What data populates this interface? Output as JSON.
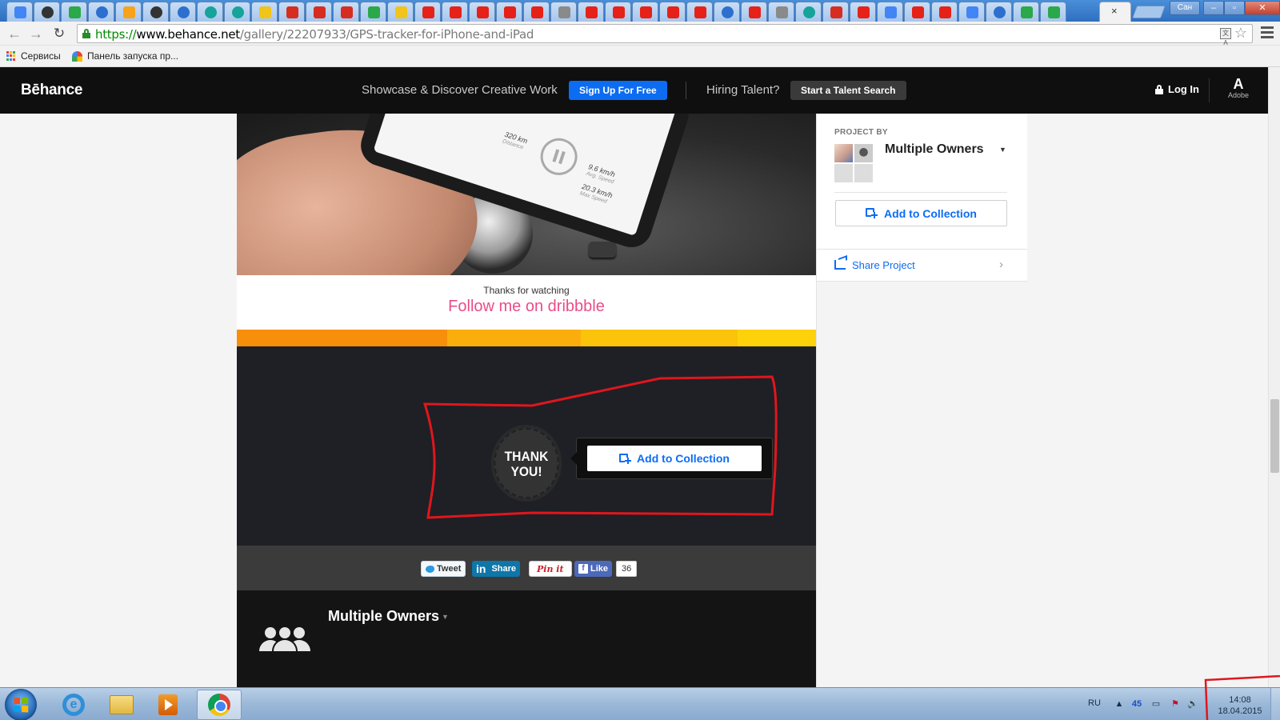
{
  "browser": {
    "tab_icons": [
      "g",
      "dk",
      "gr",
      "bl",
      "or",
      "dk",
      "bl",
      "tl",
      "tl",
      "ye",
      "rd",
      "rd",
      "rd",
      "gr",
      "ye",
      "yt",
      "yt",
      "yt",
      "yt",
      "yt",
      "gy",
      "yt",
      "yt",
      "yt",
      "yt",
      "yt",
      "bl",
      "yt",
      "gy",
      "tl",
      "rd",
      "yt",
      "g",
      "yt",
      "yt",
      "g",
      "bl",
      "gr",
      "gr"
    ],
    "active_tab_close": "×",
    "user_button": "Сан",
    "minimize": "–",
    "maximize": "▫",
    "close": "✕",
    "back": "←",
    "forward": "→",
    "reload": "↻",
    "url_scheme": "https://",
    "url_host": "www.behance.net",
    "url_path": "/gallery/22207933/GPS-tracker-for-iPhone-and-iPad",
    "star": "☆",
    "translate": "文A"
  },
  "bookmarks": {
    "apps_label": "Сервисы",
    "launcher_label": "Панель запуска пр..."
  },
  "header": {
    "logo": "Bēhance",
    "tagline": "Showcase & Discover Creative Work",
    "signup": "Sign Up For Free",
    "hiring": "Hiring Talent?",
    "talent_search": "Start a Talent Search",
    "login": "Log In",
    "adobe_glyph": "A",
    "adobe_label": "Adobe"
  },
  "project": {
    "phone_stats": [
      "320 km",
      "Distance",
      "9.6 km/h",
      "Avg. Speed",
      "20.3 km/h",
      "Max Speed"
    ],
    "thanks_small": "Thanks for watching",
    "dribbble_link": "Follow me on dribbble",
    "color_bar": [
      "#f78f0b",
      "#fbae0b",
      "#fbc30a",
      "#fdd20b"
    ],
    "thank_you_line1": "THANK",
    "thank_you_line2": "YOU!",
    "add_to_collection": "Add to Collection",
    "share": {
      "tweet": "Tweet",
      "linkedin_logo": "in",
      "linkedin": "Share",
      "pinterest": "Pin it",
      "fb_logo": "f",
      "fb_like": "Like",
      "fb_count": "36"
    },
    "owners_name": "Multiple Owners",
    "caret": "▼"
  },
  "sidebar": {
    "project_by": "PROJECT BY",
    "owners_name": "Multiple Owners",
    "caret": "▼",
    "add_to_collection": "Add to Collection",
    "share_project": "Share Project",
    "chevron": "›"
  },
  "taskbar": {
    "ie_glyph": "e",
    "language": "RU",
    "tray_icons": [
      "▲",
      "45",
      "▭",
      "⚑",
      "🔈"
    ],
    "time": "14:08",
    "date": "18.04.2015"
  },
  "colors": {
    "behance_blue": "#0c6cf2",
    "dribbble_pink": "#ea4c89",
    "annotation_red": "#e0161c"
  }
}
